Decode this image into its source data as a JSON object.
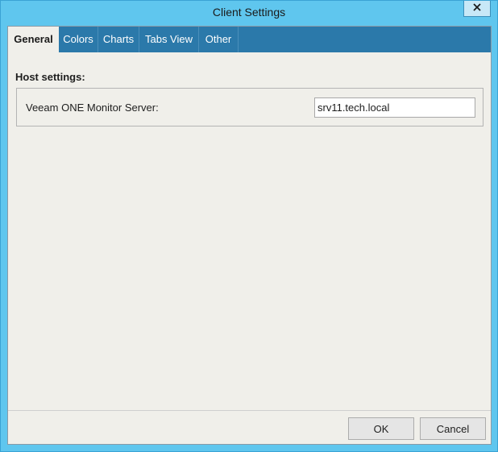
{
  "window": {
    "title": "Client Settings",
    "close_glyph": "✕"
  },
  "tabs": [
    {
      "label": "General",
      "active": true
    },
    {
      "label": "Colors",
      "active": false
    },
    {
      "label": "Charts",
      "active": false
    },
    {
      "label": "Tabs View",
      "active": false
    },
    {
      "label": "Other",
      "active": false
    }
  ],
  "general": {
    "section_title": "Host settings:",
    "server_label": "Veeam ONE Monitor Server:",
    "server_value": "srv11.tech.local"
  },
  "buttons": {
    "ok": "OK",
    "cancel": "Cancel"
  },
  "colors": {
    "frame": "#5fc6ee",
    "tabstrip": "#2b79aa",
    "client_bg": "#f0efea"
  }
}
